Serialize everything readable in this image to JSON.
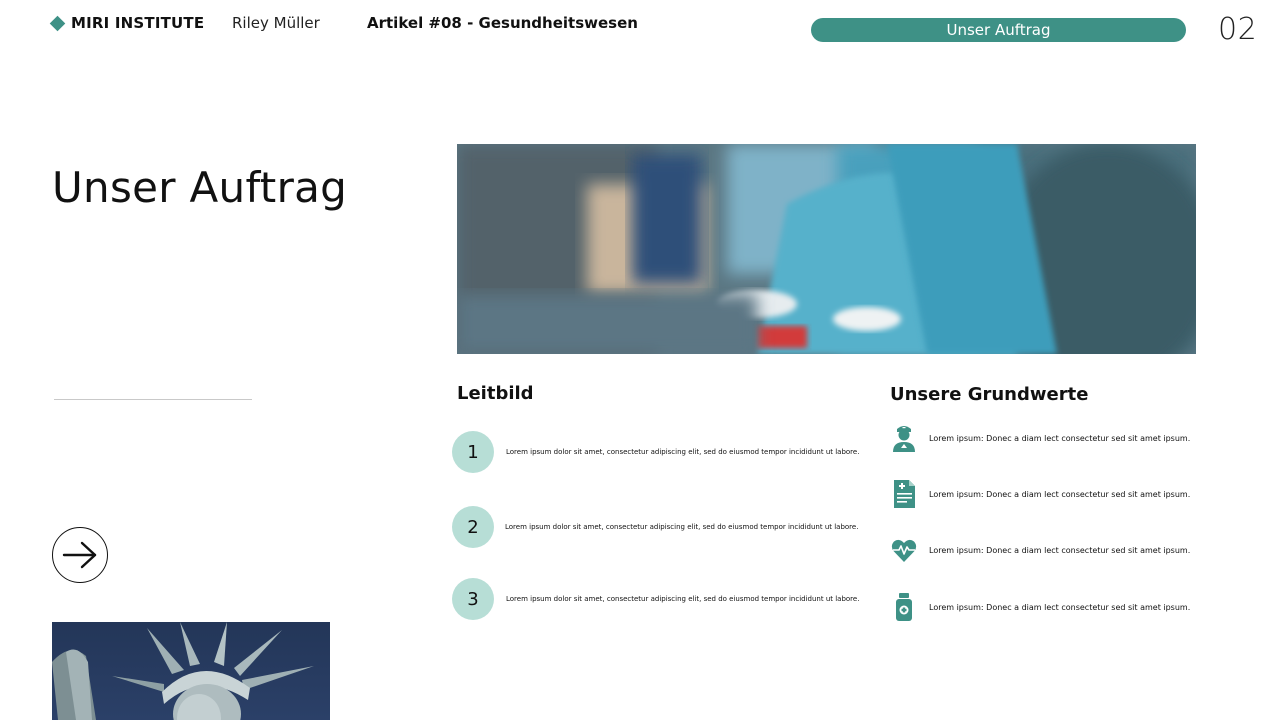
{
  "header": {
    "brand": "MIRI INSTITUTE",
    "author": "Riley Müller",
    "article": "Artikel #08 - Gesundheitswesen",
    "pill": "Unser Auftrag",
    "page_number": "02"
  },
  "main": {
    "title": "Unser Auftrag"
  },
  "leitbild": {
    "title": "Leitbild",
    "items": [
      {
        "num": "1",
        "text": "Lorem ipsum dolor sit amet, consectetur adipiscing elit, sed do eiusmod tempor incididunt ut labore."
      },
      {
        "num": "2",
        "text": "Lorem ipsum dolor sit amet, consectetur adipiscing elit, sed do eiusmod tempor incididunt ut labore."
      },
      {
        "num": "3",
        "text": "Lorem ipsum dolor sit amet, consectetur adipiscing elit, sed do eiusmod tempor incididunt ut labore."
      }
    ]
  },
  "grundwerte": {
    "title": "Unsere Grundwerte",
    "items": [
      {
        "icon": "doctor-icon",
        "text": "Lorem ipsum: Donec a diam lect consectetur sed sit amet ipsum."
      },
      {
        "icon": "medical-report-icon",
        "text": "Lorem ipsum: Donec a diam lect consectetur sed sit amet ipsum."
      },
      {
        "icon": "heart-pulse-icon",
        "text": "Lorem ipsum: Donec a diam lect consectetur sed sit amet ipsum."
      },
      {
        "icon": "medicine-bottle-icon",
        "text": "Lorem ipsum: Donec a diam lect consectetur sed sit amet ipsum."
      }
    ]
  },
  "colors": {
    "accent": "#3e9186",
    "accent_light": "#b7ded6"
  }
}
